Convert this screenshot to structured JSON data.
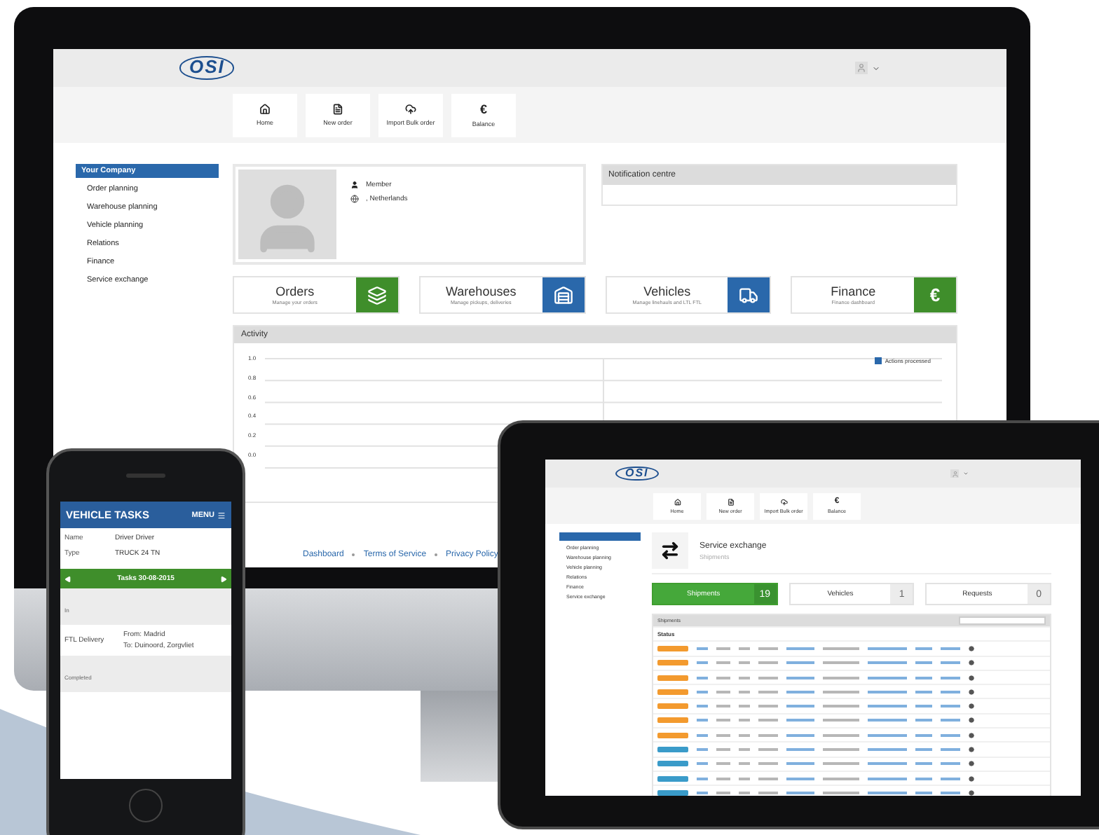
{
  "desktop": {
    "logo": "OSI",
    "toolbar": [
      {
        "kind": "home",
        "label": "Home"
      },
      {
        "kind": "file",
        "label": "New order"
      },
      {
        "kind": "upload",
        "label": "Import Bulk order"
      },
      {
        "kind": "symbol",
        "symbol": "€",
        "label": "Balance"
      }
    ],
    "sidebar": [
      {
        "label": "Your Company",
        "selected": true
      },
      {
        "label": "Order planning",
        "selected": false
      },
      {
        "label": "Warehouse planning",
        "selected": false
      },
      {
        "label": "Vehicle planning",
        "selected": false
      },
      {
        "label": "Relations",
        "selected": false
      },
      {
        "label": "Finance",
        "selected": false
      },
      {
        "label": "Service exchange",
        "selected": false
      }
    ],
    "profile": {
      "role": "Member",
      "location": ", Netherlands"
    },
    "notifications": {
      "title": "Notification centre"
    },
    "tiles": [
      {
        "title": "Orders",
        "subtitle": "Manage your orders",
        "kind": "layers",
        "color": "#3f8e2b"
      },
      {
        "title": "Warehouses",
        "subtitle": "Manage pickups, deliveries",
        "kind": "warehouse",
        "color": "#2a68ab"
      },
      {
        "title": "Vehicles",
        "subtitle": "Manage linehauls and LTL FTL",
        "kind": "truck",
        "color": "#2a68ab"
      },
      {
        "title": "Finance",
        "subtitle": "Finance dashboard",
        "kind": "symbol",
        "symbol": "€",
        "color": "#3f8e2b"
      }
    ],
    "activity": {
      "title": "Activity",
      "y_ticks": [
        "1.0",
        "0.8",
        "0.6",
        "0.4",
        "0.2",
        "0.0"
      ],
      "legend": "Actions processed"
    },
    "footer": [
      "Dashboard",
      "Terms of Service",
      "Privacy Policy"
    ]
  },
  "phone": {
    "title": "VEHICLE TASKS",
    "menu": "MENU",
    "fields": [
      {
        "label": "Name",
        "value": "Driver Driver"
      },
      {
        "label": "Type",
        "value": "TRUCK 24 TN"
      }
    ],
    "date_nav": "Tasks 30-08-2015",
    "section": "In",
    "task": {
      "type": "FTL Delivery",
      "from": "From: Madrid",
      "to": "To: Duinoord, Zorgvliet"
    },
    "footer_section": "Completed"
  },
  "tablet": {
    "logo": "OSI",
    "toolbar": [
      {
        "kind": "home",
        "label": "Home"
      },
      {
        "kind": "file",
        "label": "New order"
      },
      {
        "kind": "upload",
        "label": "Import Bulk order"
      },
      {
        "kind": "symbol",
        "symbol": "€",
        "label": "Balance"
      }
    ],
    "sidebar": [
      {
        "label": "Order planning"
      },
      {
        "label": "Warehouse planning"
      },
      {
        "label": "Vehicle planning"
      },
      {
        "label": "Relations"
      },
      {
        "label": "Finance"
      },
      {
        "label": "Service exchange"
      }
    ],
    "heading": "Service exchange",
    "subheading": "Shipments",
    "counters": [
      {
        "label": "Shipments",
        "count": "19",
        "selected": true
      },
      {
        "label": "Vehicles",
        "count": "1",
        "selected": false
      },
      {
        "label": "Requests",
        "count": "0",
        "selected": false
      }
    ],
    "panel_title": "Shipments",
    "first_column": "Status",
    "rows": [
      {
        "color": "#f39a2e"
      },
      {
        "color": "#f39a2e"
      },
      {
        "color": "#f39a2e"
      },
      {
        "color": "#f39a2e"
      },
      {
        "color": "#f39a2e"
      },
      {
        "color": "#f39a2e"
      },
      {
        "color": "#f39a2e"
      },
      {
        "color": "#3a9bc9"
      },
      {
        "color": "#3a9bc9"
      },
      {
        "color": "#3a9bc9"
      },
      {
        "color": "#3a9bc9"
      }
    ]
  }
}
